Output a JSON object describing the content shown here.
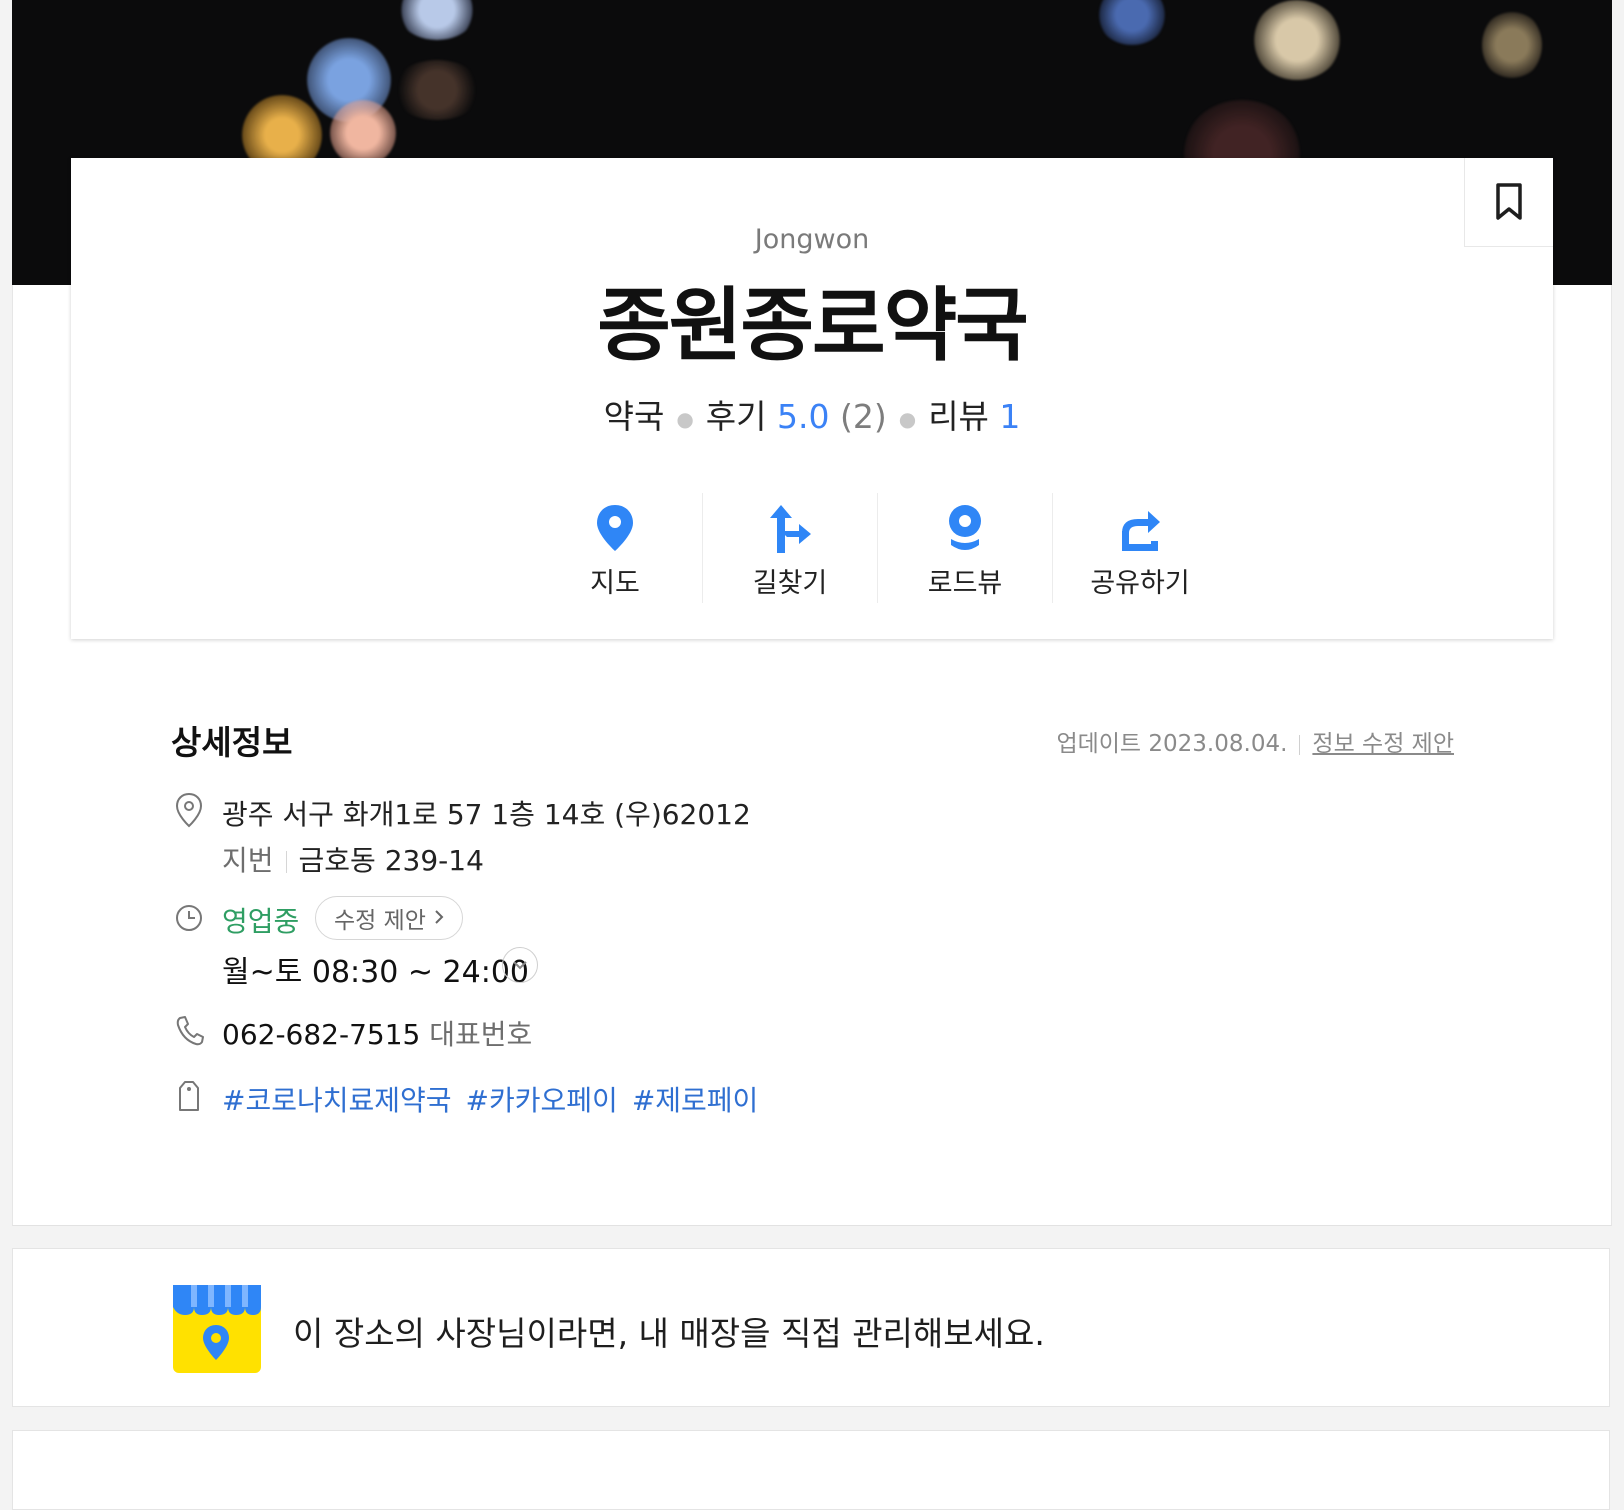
{
  "place": {
    "subname": "Jongwon",
    "name": "종원종로약국",
    "category": "약국",
    "review_label": "후기",
    "rating": "5.0",
    "rating_count": "(2)",
    "blog_review_label": "리뷰",
    "blog_review_count": "1"
  },
  "actions": [
    {
      "label": "지도",
      "icon": "map-pin-icon"
    },
    {
      "label": "길찾기",
      "icon": "directions-icon"
    },
    {
      "label": "로드뷰",
      "icon": "roadview-icon"
    },
    {
      "label": "공유하기",
      "icon": "share-icon"
    }
  ],
  "detail": {
    "title": "상세정보",
    "update_text": "업데이트 2023.08.04.",
    "edit_suggest_link": "정보 수정 제안",
    "address": "광주 서구 화개1로 57 1층 14호 (우)62012",
    "jibun_label": "지번",
    "jibun_address": "금호동 239-14",
    "open_status": "영업중",
    "hours_suggest": "수정 제안",
    "hours": "월~토  08:30 ~ 24:00",
    "phone": "062-682-7515",
    "phone_note": "대표번호",
    "tags": [
      "#코로나치료제약국",
      "#카카오페이",
      "#제로페이"
    ]
  },
  "owner": {
    "message": "이 장소의 사장님이라면, 내 매장을 직접 관리해보세요."
  },
  "colors": {
    "accent_blue": "#3b82f6",
    "open_green": "#2f9e63",
    "tag_blue": "#2f6fd1",
    "owner_yellow": "#ffe100"
  }
}
